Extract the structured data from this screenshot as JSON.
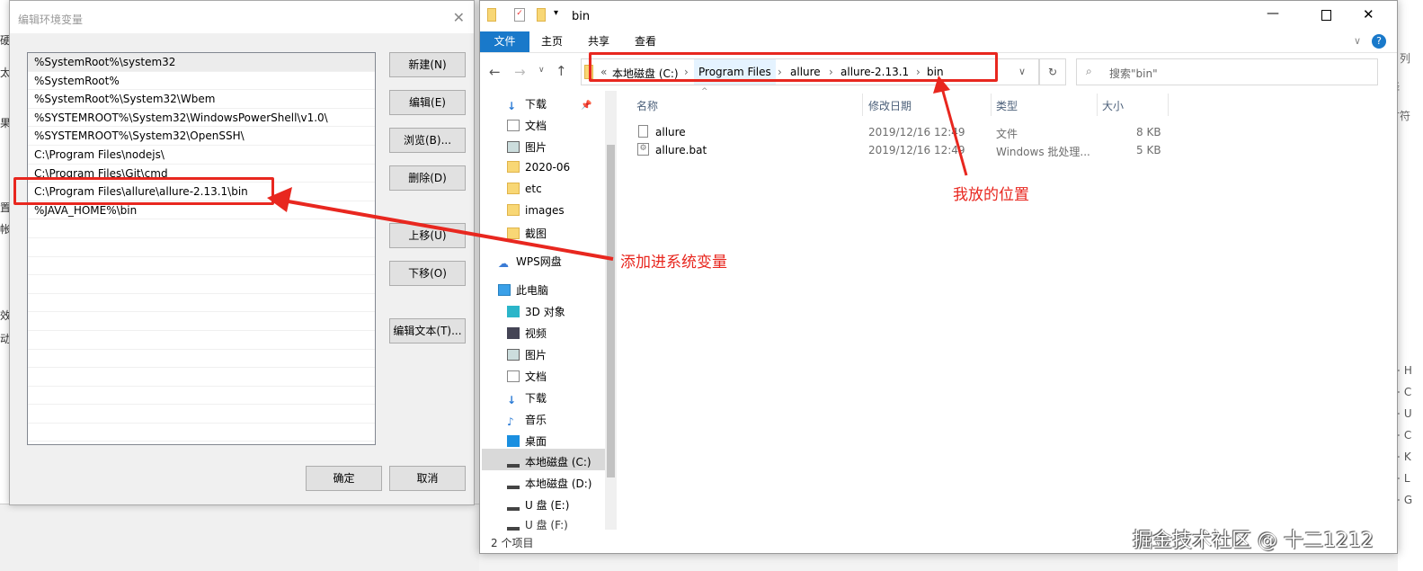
{
  "background": {
    "left_fragments": [
      "硬",
      "太多",
      "果",
      "置",
      "帐",
      "效",
      "动"
    ],
    "right_fragments": [
      "列",
      "择",
      "甘符"
    ],
    "right_list": [
      "+ H",
      "+ C",
      "+ U",
      "+ C",
      "+ K",
      "+ L",
      "+ G"
    ]
  },
  "dialog": {
    "title": "编辑环境变量",
    "entries": [
      "%SystemRoot%\\system32",
      "%SystemRoot%",
      "%SystemRoot%\\System32\\Wbem",
      "%SYSTEMROOT%\\System32\\WindowsPowerShell\\v1.0\\",
      "%SYSTEMROOT%\\System32\\OpenSSH\\",
      "C:\\Program Files\\nodejs\\",
      "C:\\Program Files\\Git\\cmd",
      "C:\\Program Files\\allure\\allure-2.13.1\\bin",
      "%JAVA_HOME%\\bin"
    ],
    "buttons": {
      "new": "新建(N)",
      "edit": "编辑(E)",
      "browse": "浏览(B)...",
      "delete": "删除(D)",
      "up": "上移(U)",
      "down": "下移(O)",
      "edit_text": "编辑文本(T)...",
      "ok": "确定",
      "cancel": "取消"
    }
  },
  "explorer": {
    "title": "bin",
    "ribbon_tabs": [
      "文件",
      "主页",
      "共享",
      "查看"
    ],
    "breadcrumb": [
      "«",
      "本地磁盘 (C:)",
      "Program Files",
      "allure",
      "allure-2.13.1",
      "bin"
    ],
    "search_placeholder": "搜索\"bin\"",
    "quick_access": [
      "下载",
      "文档",
      "图片",
      "2020-06",
      "etc",
      "images",
      "截图"
    ],
    "wps": "WPS网盘",
    "this_pc": "此电脑",
    "pc_items": [
      "3D 对象",
      "视频",
      "图片",
      "文档",
      "下载",
      "音乐",
      "桌面",
      "本地磁盘 (C:)",
      "本地磁盘 (D:)",
      "U 盘 (E:)",
      "U 盘 (F:)"
    ],
    "columns": [
      "名称",
      "修改日期",
      "类型",
      "大小"
    ],
    "files": [
      {
        "name": "allure",
        "date": "2019/12/16 12:49",
        "type": "文件",
        "size": "8 KB"
      },
      {
        "name": "allure.bat",
        "date": "2019/12/16 12:49",
        "type": "Windows 批处理...",
        "size": "5 KB"
      }
    ],
    "status": "2 个项目"
  },
  "annotations": {
    "add_label": "添加进系统变量",
    "location_label": "我放的位置",
    "color": "#e8271f"
  },
  "watermark": "掘金技术社区 @ 十二1212"
}
